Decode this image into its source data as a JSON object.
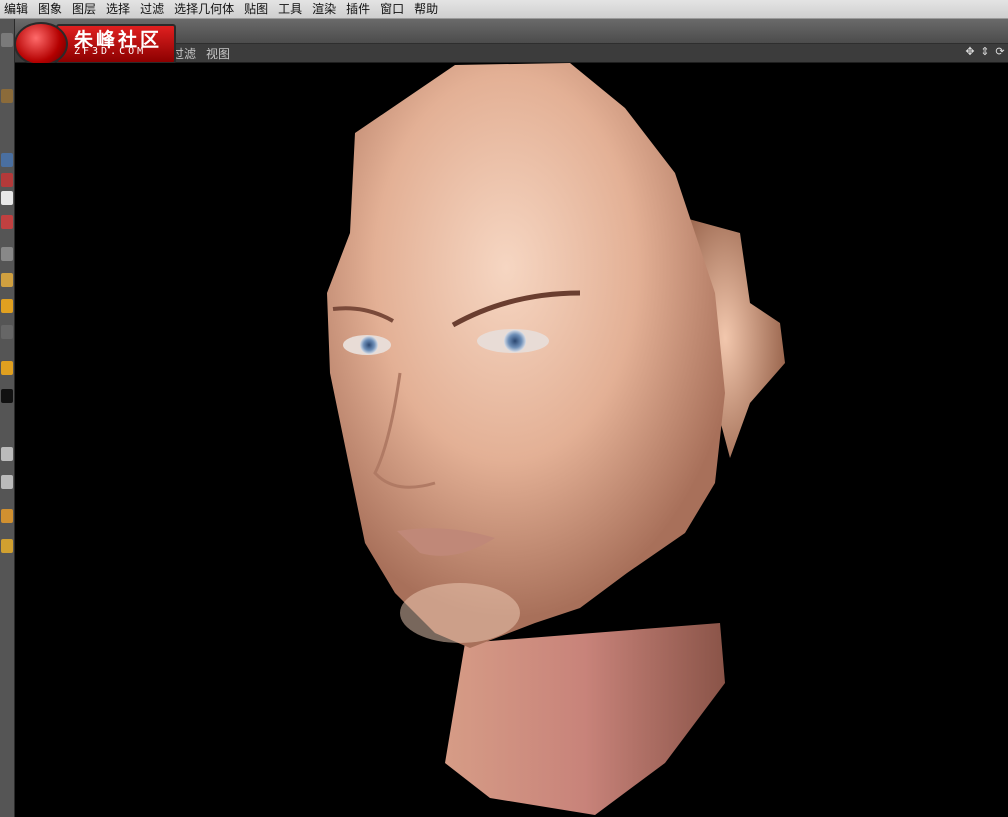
{
  "menu": {
    "items": [
      "编辑",
      "图象",
      "图层",
      "选择",
      "过滤",
      "选择几何体",
      "贴图",
      "工具",
      "渲染",
      "插件",
      "窗口",
      "帮助"
    ]
  },
  "viewport_header": {
    "menus": [
      "过滤",
      "视图"
    ]
  },
  "logo": {
    "title": "朱峰社区",
    "subtitle": "ZF3D.COM"
  },
  "icons": {
    "nav": [
      "move-icon",
      "dolly-icon",
      "rotate-icon"
    ]
  },
  "colors": {
    "menubar": "#d8d8d8",
    "toolbar": "#5a5a5a",
    "viewport_bg": "#000000",
    "skin": "#e8b998",
    "logo_red": "#c80000"
  }
}
